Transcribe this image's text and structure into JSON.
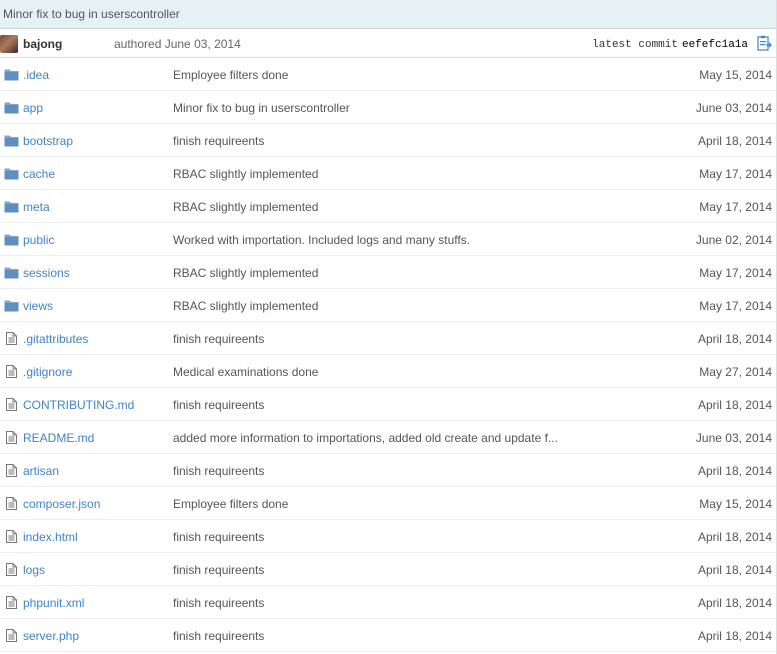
{
  "commit": {
    "title": "Minor fix to bug in userscontroller",
    "author": "bajong",
    "authored": "authored June 03, 2014",
    "latest_label": "latest commit",
    "sha": "eefefc1a1a"
  },
  "files": [
    {
      "name": ".idea",
      "type": "folder",
      "message": "Employee filters done",
      "date": "May 15, 2014"
    },
    {
      "name": "app",
      "type": "folder",
      "message": "Minor fix to bug in userscontroller",
      "date": "June 03, 2014"
    },
    {
      "name": "bootstrap",
      "type": "folder",
      "message": "finish requireents",
      "date": "April 18, 2014"
    },
    {
      "name": "cache",
      "type": "folder",
      "message": "RBAC slightly implemented",
      "date": "May 17, 2014"
    },
    {
      "name": "meta",
      "type": "folder",
      "message": "RBAC slightly implemented",
      "date": "May 17, 2014"
    },
    {
      "name": "public",
      "type": "folder",
      "message": "Worked with importation. Included logs and many stuffs.",
      "date": "June 02, 2014"
    },
    {
      "name": "sessions",
      "type": "folder",
      "message": "RBAC slightly implemented",
      "date": "May 17, 2014"
    },
    {
      "name": "views",
      "type": "folder",
      "message": "RBAC slightly implemented",
      "date": "May 17, 2014"
    },
    {
      "name": ".gitattributes",
      "type": "file",
      "message": "finish requireents",
      "date": "April 18, 2014"
    },
    {
      "name": ".gitignore",
      "type": "file",
      "message": "Medical examinations done",
      "date": "May 27, 2014"
    },
    {
      "name": "CONTRIBUTING.md",
      "type": "file",
      "message": "finish requireents",
      "date": "April 18, 2014"
    },
    {
      "name": "README.md",
      "type": "file",
      "message": "added more information to importations, added old create and update f...",
      "date": "June 03, 2014"
    },
    {
      "name": "artisan",
      "type": "file",
      "message": "finish requireents",
      "date": "April 18, 2014"
    },
    {
      "name": "composer.json",
      "type": "file",
      "message": "Employee filters done",
      "date": "May 15, 2014"
    },
    {
      "name": "index.html",
      "type": "file",
      "message": "finish requireents",
      "date": "April 18, 2014"
    },
    {
      "name": "logs",
      "type": "file",
      "message": "finish requireents",
      "date": "April 18, 2014"
    },
    {
      "name": "phpunit.xml",
      "type": "file",
      "message": "finish requireents",
      "date": "April 18, 2014"
    },
    {
      "name": "server.php",
      "type": "file",
      "message": "finish requireents",
      "date": "April 18, 2014"
    }
  ],
  "colors": {
    "link": "#4183c4",
    "folder_icon": "#80a6cd",
    "file_icon": "#777777",
    "header_bg": "#e6f1f6"
  },
  "icons": {
    "folder": "folder-icon",
    "file": "file-icon",
    "copy": "clipboard-icon"
  }
}
